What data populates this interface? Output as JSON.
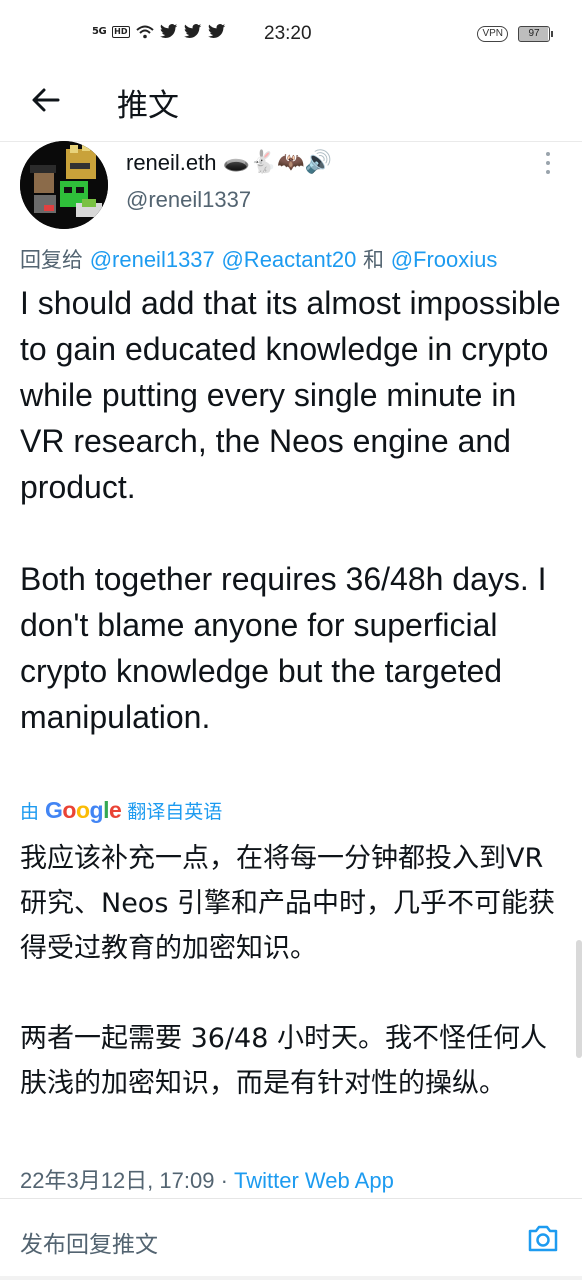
{
  "status_bar": {
    "network": "5G",
    "hd": "HD",
    "time": "23:20",
    "vpn": "VPN",
    "battery": "97",
    "icons": [
      "wifi-icon",
      "twitter-icon",
      "twitter-icon",
      "twitter-icon"
    ]
  },
  "header": {
    "back_icon": "arrow-left-icon",
    "title": "推文"
  },
  "author": {
    "name": "reneil.eth",
    "emoji": "🕳️🐇🦇🔊",
    "handle": "@reneil1337"
  },
  "reply_to": {
    "prefix": "回复给 ",
    "users": [
      "@reneil1337",
      "@Reactant20"
    ],
    "conjunction": " 和 ",
    "last_user": "@Frooxius"
  },
  "tweet": {
    "text": "I should add that its almost impossible to gain educated knowledge in crypto while putting every single minute in VR research, the Neos engine and product.\n\nBoth together requires 36/48h days. I don't blame anyone for superficial crypto knowledge but the targeted manipulation."
  },
  "translation": {
    "by_prefix": "由",
    "provider": "Google",
    "suffix": "翻译自英语",
    "text": "我应该补充一点，在将每一分钟都投入到VR 研究、Neos 引擎和产品中时，几乎不可能获得受过教育的加密知识。\n\n两者一起需要 36/48 小时天。我不怪任何人肤浅的加密知识，而是有针对性的操纵。"
  },
  "meta": {
    "timestamp": "22年3月12日, 17:09",
    "separator": " · ",
    "source": "Twitter Web App"
  },
  "reply_bar": {
    "placeholder": "发布回复推文",
    "camera_icon": "camera-icon"
  },
  "colors": {
    "link": "#1d9bf0",
    "muted": "#536471",
    "text": "#0f1419"
  }
}
